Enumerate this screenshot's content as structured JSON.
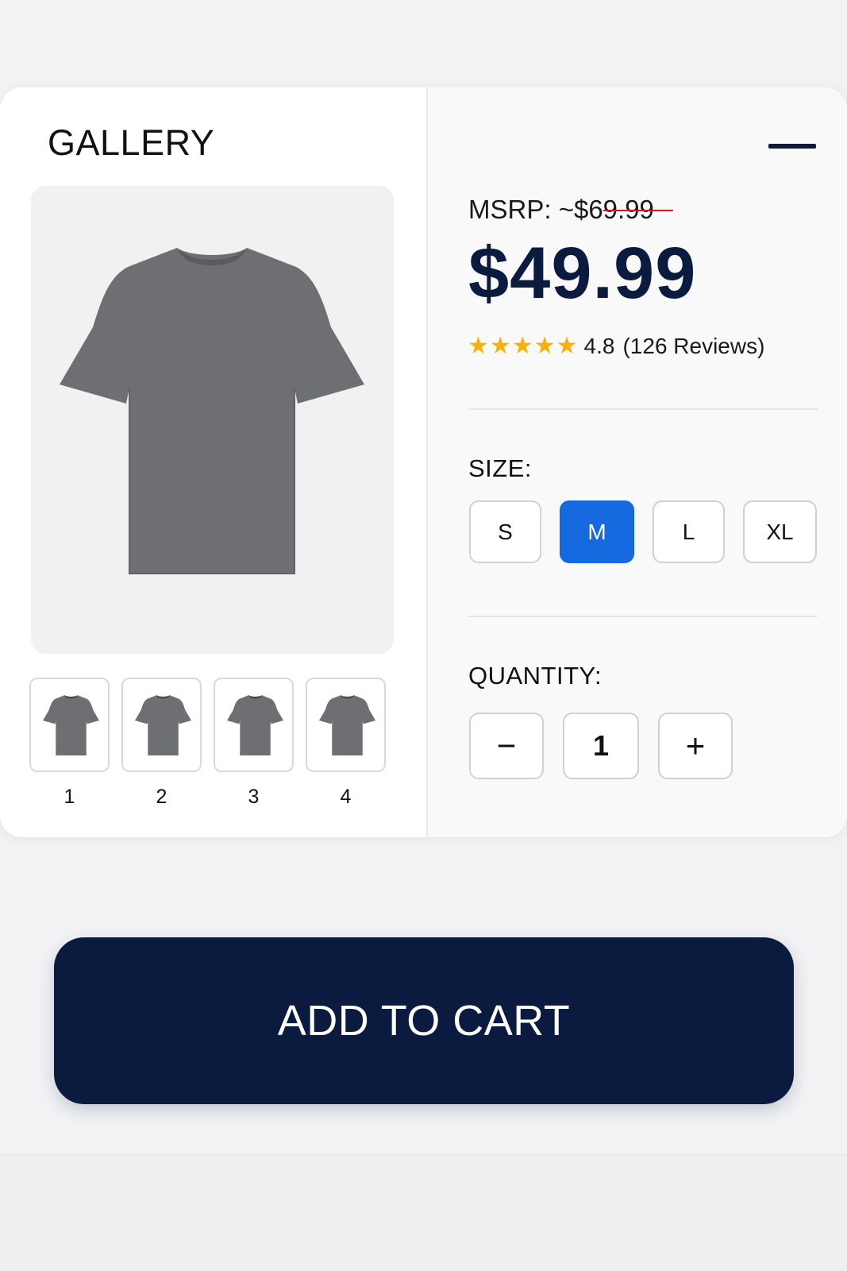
{
  "gallery": {
    "title": "GALLERY",
    "thumbnails": [
      {
        "label": "1"
      },
      {
        "label": "2"
      },
      {
        "label": "3"
      },
      {
        "label": "4"
      }
    ]
  },
  "product": {
    "msrp_label": "MSRP:",
    "msrp_prefix": "~",
    "msrp_value": "$69.99",
    "price": "$49.99",
    "rating_value": "4.8",
    "rating_count": "(126 Reviews)",
    "stars": 5
  },
  "size": {
    "label": "SIZE:",
    "options": [
      "S",
      "M",
      "L",
      "XL"
    ],
    "selected": "M"
  },
  "quantity": {
    "label": "QUANTITY:",
    "decrement": "−",
    "value": "1",
    "increment": "+"
  },
  "cta": {
    "add_to_cart": "ADD TO CART"
  },
  "colors": {
    "primary_navy": "#0b1b3f",
    "selected_blue": "#1769e0",
    "star_gold": "#f5b015",
    "strike_red": "#d21c1c",
    "shirt_gray": "#6e6f72"
  },
  "icons": {
    "menu": "menu-dash-icon",
    "star": "star-icon"
  }
}
